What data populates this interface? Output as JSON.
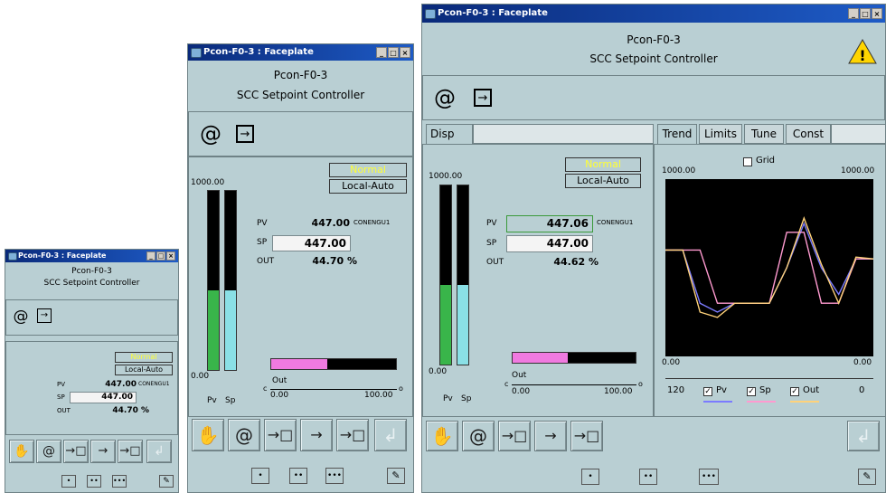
{
  "app": {
    "window_title": "Pcon-F0-3 : Faceplate",
    "window_title_small": "Pcon-F0-3 : Faceplate",
    "tag": "Pcon-F0-3",
    "description": "SCC Setpoint Controller",
    "win_buttons": [
      "_",
      "□",
      "×"
    ]
  },
  "status": {
    "alarm": "Normal",
    "mode": "Local-Auto",
    "warning_glyph": "!"
  },
  "small": {
    "pv_label": "PV",
    "pv_value": "447.00",
    "pv_unit": "CONENGU1",
    "sp_label": "SP",
    "sp_value": "447.00",
    "out_label": "OUT",
    "out_value": "44.70 %"
  },
  "medium": {
    "scale_max": "1000.00",
    "scale_min": "0.00",
    "pv_label": "PV",
    "pv_value": "447.00",
    "pv_unit": "CONENGU1",
    "sp_label": "SP",
    "sp_value": "447.00",
    "out_label": "OUT",
    "out_value": "44.70 %",
    "bar_labels": [
      "Pv",
      "Sp"
    ],
    "out_bar_label": "Out",
    "out_min": "0.00",
    "out_max": "100.00",
    "out_c": "c",
    "out_o": "o",
    "pv_fraction": 0.447,
    "sp_fraction": 0.447,
    "out_fraction": 0.447
  },
  "large": {
    "tab_left": "Disp",
    "tabs_right": [
      "Trend",
      "Limits",
      "Tune",
      "Const"
    ],
    "scale_max": "1000.00",
    "scale_min": "0.00",
    "pv_label": "PV",
    "pv_value": "447.06",
    "pv_unit": "CONENGU1",
    "sp_label": "SP",
    "sp_value": "447.00",
    "out_label": "OUT",
    "out_value": "44.62 %",
    "bar_labels": [
      "Pv",
      "Sp"
    ],
    "out_bar_label": "Out",
    "out_min": "0.00",
    "out_max": "100.00",
    "out_c": "c",
    "out_o": "o",
    "pv_fraction": 0.447,
    "sp_fraction": 0.447,
    "out_fraction": 0.446,
    "trend": {
      "grid_label": "Grid",
      "y_max_left": "1000.00",
      "y_max_right": "1000.00",
      "y_min_left": "0.00",
      "y_min_right": "0.00",
      "x_left": "120",
      "x_right": "0",
      "legend": [
        "Pv",
        "Sp",
        "Out"
      ]
    }
  },
  "chart_data": {
    "type": "line",
    "x": [
      120,
      110,
      100,
      90,
      80,
      70,
      60,
      50,
      40,
      30,
      20,
      10,
      0
    ],
    "ylim": [
      0,
      1000
    ],
    "xlim": [
      120,
      0
    ],
    "series": [
      {
        "name": "Pv",
        "values": [
          600,
          600,
          300,
          250,
          300,
          300,
          300,
          500,
          750,
          500,
          350,
          550,
          550
        ]
      },
      {
        "name": "Sp",
        "values": [
          600,
          600,
          600,
          300,
          300,
          300,
          300,
          700,
          700,
          300,
          300,
          550,
          550
        ]
      },
      {
        "name": "Out",
        "values": [
          600,
          600,
          250,
          220,
          300,
          300,
          300,
          500,
          780,
          520,
          300,
          560,
          550
        ]
      }
    ],
    "legend": [
      "Pv",
      "Sp",
      "Out"
    ],
    "grid": false,
    "colors": {
      "Pv": "#7b7bff",
      "Sp": "#ff9ad0",
      "Out": "#ffd27a"
    }
  },
  "footer": {
    "view_buttons": [
      "•",
      "••",
      "•••"
    ],
    "pin_glyph": "✎"
  },
  "colors": {
    "panel": "#b9cfd3",
    "pv_bar": "#39b54a",
    "sp_bar": "#8ae0e6",
    "out_bar": "#f07ae0",
    "alarm_text": "#ffff33",
    "warning": "#ffd500"
  }
}
